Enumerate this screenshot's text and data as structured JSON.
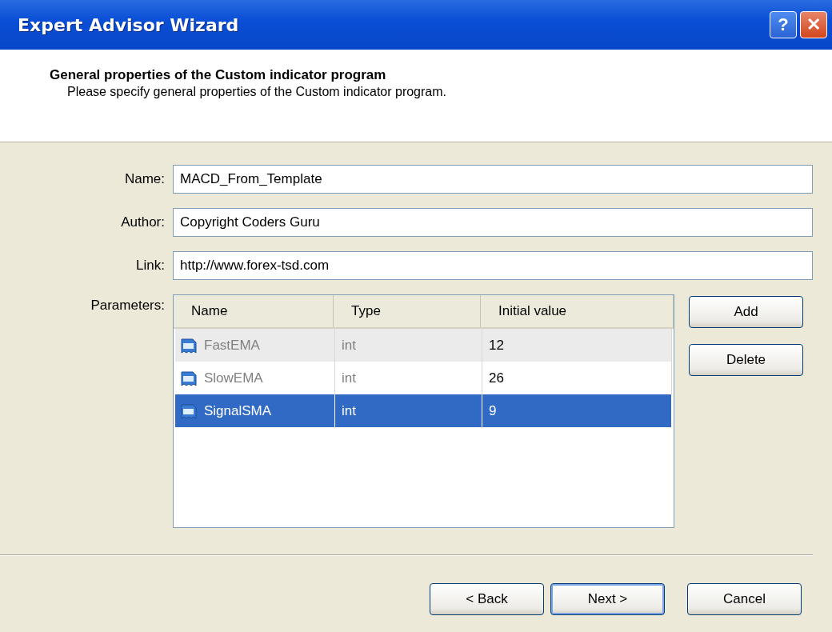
{
  "window": {
    "title": "Expert Advisor Wizard",
    "title_buttons": [
      "?",
      "✕"
    ]
  },
  "header": {
    "title": "General properties of the Custom indicator program",
    "subtitle": "Please specify general properties of the Custom indicator program."
  },
  "fields": [
    {
      "label": "Name:",
      "value": "MACD_From_Template"
    },
    {
      "label": "Author:",
      "value": "Copyright Coders Guru"
    },
    {
      "label": "Link:",
      "value": "http://www.forex-tsd.com"
    }
  ],
  "parameters": {
    "label": "Parameters:",
    "columns": [
      "Name",
      "Type",
      "Initial value"
    ],
    "rows": [
      {
        "name": "FastEMA",
        "type": "int",
        "value": "12",
        "selected": false,
        "highlighted": true
      },
      {
        "name": "SlowEMA",
        "type": "int",
        "value": "26",
        "selected": false,
        "highlighted": false
      },
      {
        "name": "SignalSMA",
        "type": "int",
        "value": "9",
        "selected": true,
        "highlighted": false
      }
    ],
    "buttons": [
      "Add",
      "Delete"
    ]
  },
  "footer_buttons": [
    {
      "label": "< Back",
      "default": false
    },
    {
      "label": "Next >",
      "default": true
    },
    {
      "label": "Cancel",
      "default": false
    }
  ]
}
